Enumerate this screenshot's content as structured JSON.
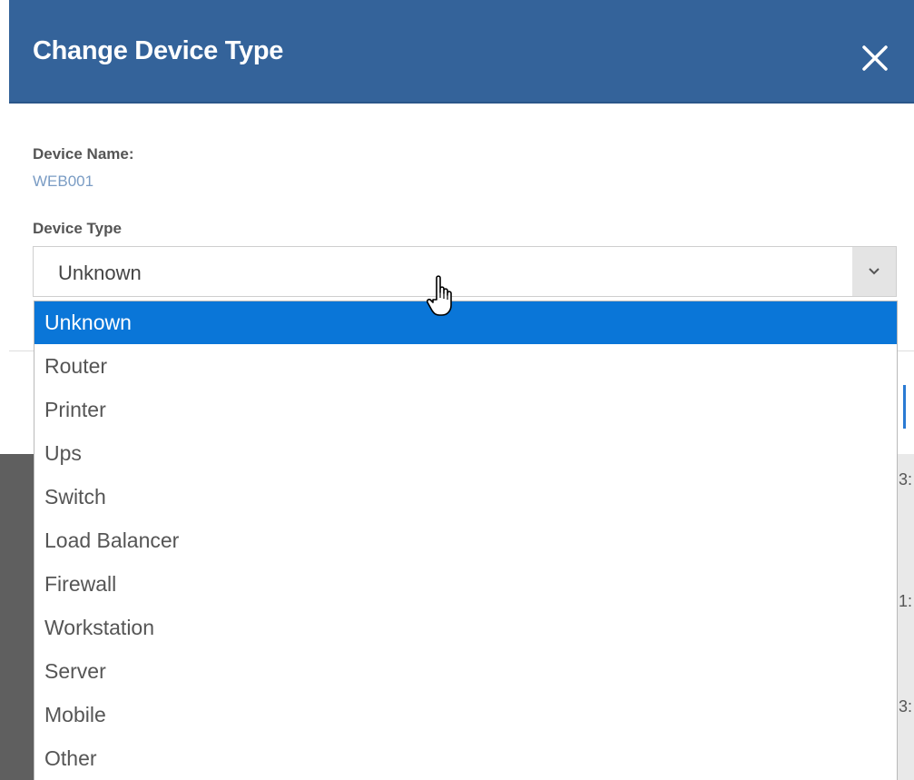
{
  "dialog": {
    "title": "Change Device Type",
    "close_label": "close"
  },
  "device_name": {
    "label": "Device Name:",
    "value": "WEB001"
  },
  "device_type": {
    "label": "Device Type",
    "selected": "Unknown",
    "options": [
      "Unknown",
      "Router",
      "Printer",
      "Ups",
      "Switch",
      "Load Balancer",
      "Firewall",
      "Workstation",
      "Server",
      "Mobile",
      "Other"
    ]
  },
  "background_peek": [
    "3:",
    "1:",
    "3:"
  ],
  "colors": {
    "header": "#34639a",
    "selected_option": "#0a76d8",
    "value_text": "#7a9cc4"
  },
  "icons": {
    "close": "close-icon",
    "dropdown": "chevron-down-icon",
    "cursor": "hand-pointer-icon"
  }
}
